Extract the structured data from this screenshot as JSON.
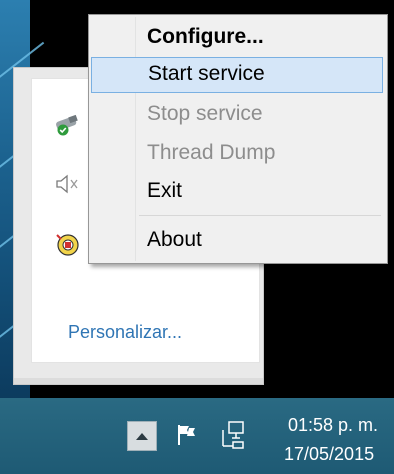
{
  "context_menu": {
    "items": [
      {
        "label": "Configure...",
        "state": "default"
      },
      {
        "label": "Start service",
        "state": "highlighted"
      },
      {
        "label": "Stop service",
        "state": "disabled"
      },
      {
        "label": "Thread Dump",
        "state": "disabled"
      },
      {
        "label": "Exit",
        "state": "normal"
      },
      {
        "label": "About",
        "state": "normal"
      }
    ]
  },
  "tray_flyout": {
    "icons": [
      "usb-device-icon",
      "speaker-icon",
      "service-app-icon"
    ],
    "personalize_link": "Personalizar..."
  },
  "taskbar": {
    "show_hidden_icons": "chevron-up-icon",
    "action_center": "flag-icon",
    "network": "network-icon",
    "clock_time": "01:58 p. m.",
    "clock_date": "17/05/2015"
  },
  "colors": {
    "menu_background": "#f0f0f0",
    "menu_highlight": "#d5e6f8",
    "menu_highlight_border": "#7ab0e2",
    "disabled_text": "#8d8d8d",
    "link": "#2f75b4",
    "taskbar": "#1e5a74"
  }
}
